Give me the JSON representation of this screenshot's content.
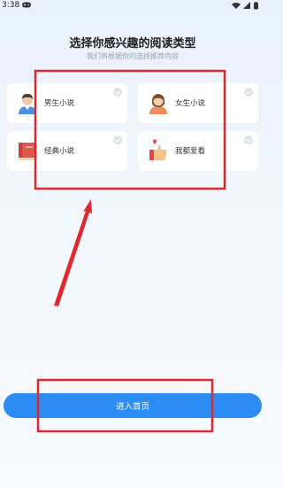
{
  "status_bar": {
    "time": "3:38"
  },
  "header": {
    "title": "选择你感兴趣的阅读类型",
    "subtitle": "我们将根据你的选择推荐内容"
  },
  "genres": [
    {
      "label": "男生小说",
      "icon": "male-avatar-icon"
    },
    {
      "label": "女生小说",
      "icon": "female-avatar-icon"
    },
    {
      "label": "经典小说",
      "icon": "book-icon"
    },
    {
      "label": "我都爱看",
      "icon": "thumbs-up-heart-icon"
    }
  ],
  "enter_button": {
    "label": "进入首页"
  },
  "colors": {
    "accent": "#2b8cf4",
    "annotation": "#e0282e"
  }
}
